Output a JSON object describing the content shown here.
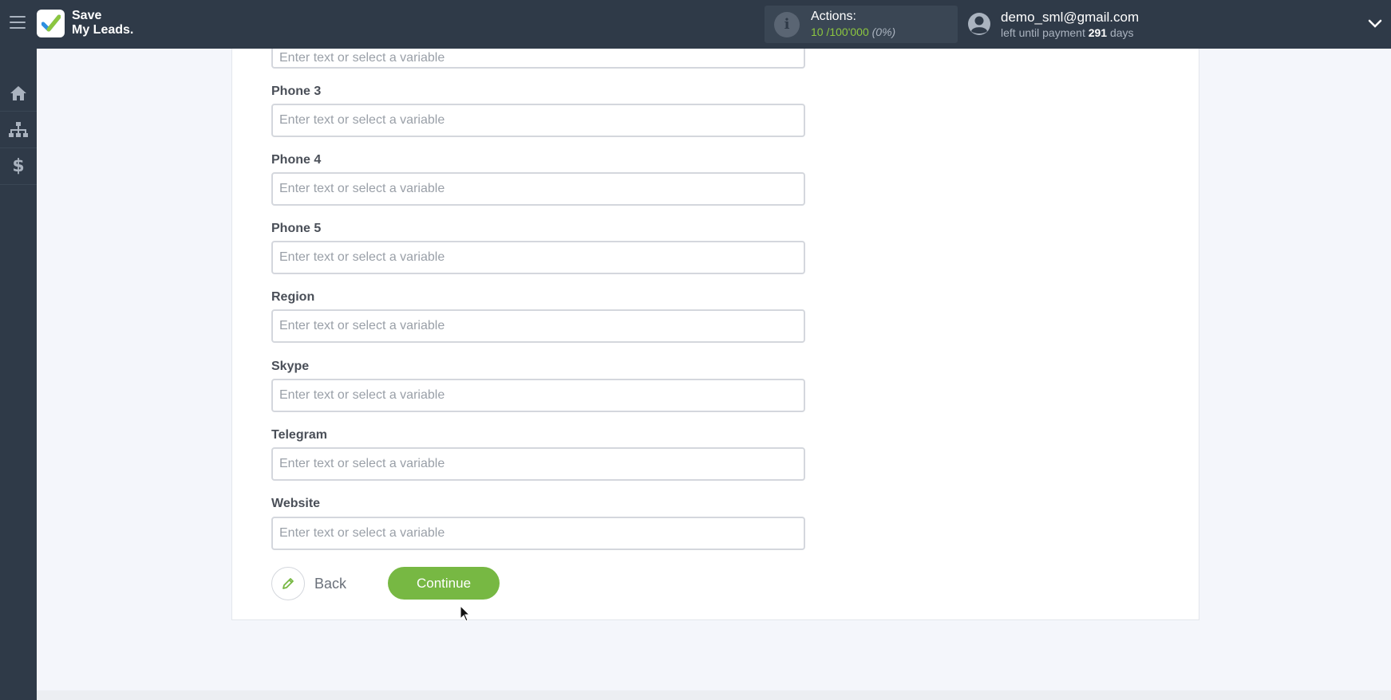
{
  "brand": {
    "name_line1": "Save",
    "name_line2": "My Leads."
  },
  "header": {
    "actions_label": "Actions:",
    "actions_used": "10",
    "actions_total": "/100'000",
    "actions_percent": "(0%)",
    "user_email": "demo_sml@gmail.com",
    "payment_prefix": "left until payment",
    "payment_days": "291",
    "payment_suffix": "days"
  },
  "sidebar": {
    "items": [
      {
        "icon": "home-icon"
      },
      {
        "icon": "sitemap-icon"
      },
      {
        "icon": "dollar-icon"
      }
    ]
  },
  "form": {
    "placeholder": "Enter text or select a variable",
    "fields": [
      {
        "label": "Phone 3",
        "value": ""
      },
      {
        "label": "Phone 4",
        "value": ""
      },
      {
        "label": "Phone 5",
        "value": ""
      },
      {
        "label": "Region",
        "value": ""
      },
      {
        "label": "Skype",
        "value": ""
      },
      {
        "label": "Telegram",
        "value": ""
      },
      {
        "label": "Website",
        "value": ""
      }
    ],
    "back_label": "Back",
    "continue_label": "Continue"
  },
  "colors": {
    "topbar": "#2f3a48",
    "accent_green": "#77b843",
    "actions_green": "#8cc63f"
  }
}
